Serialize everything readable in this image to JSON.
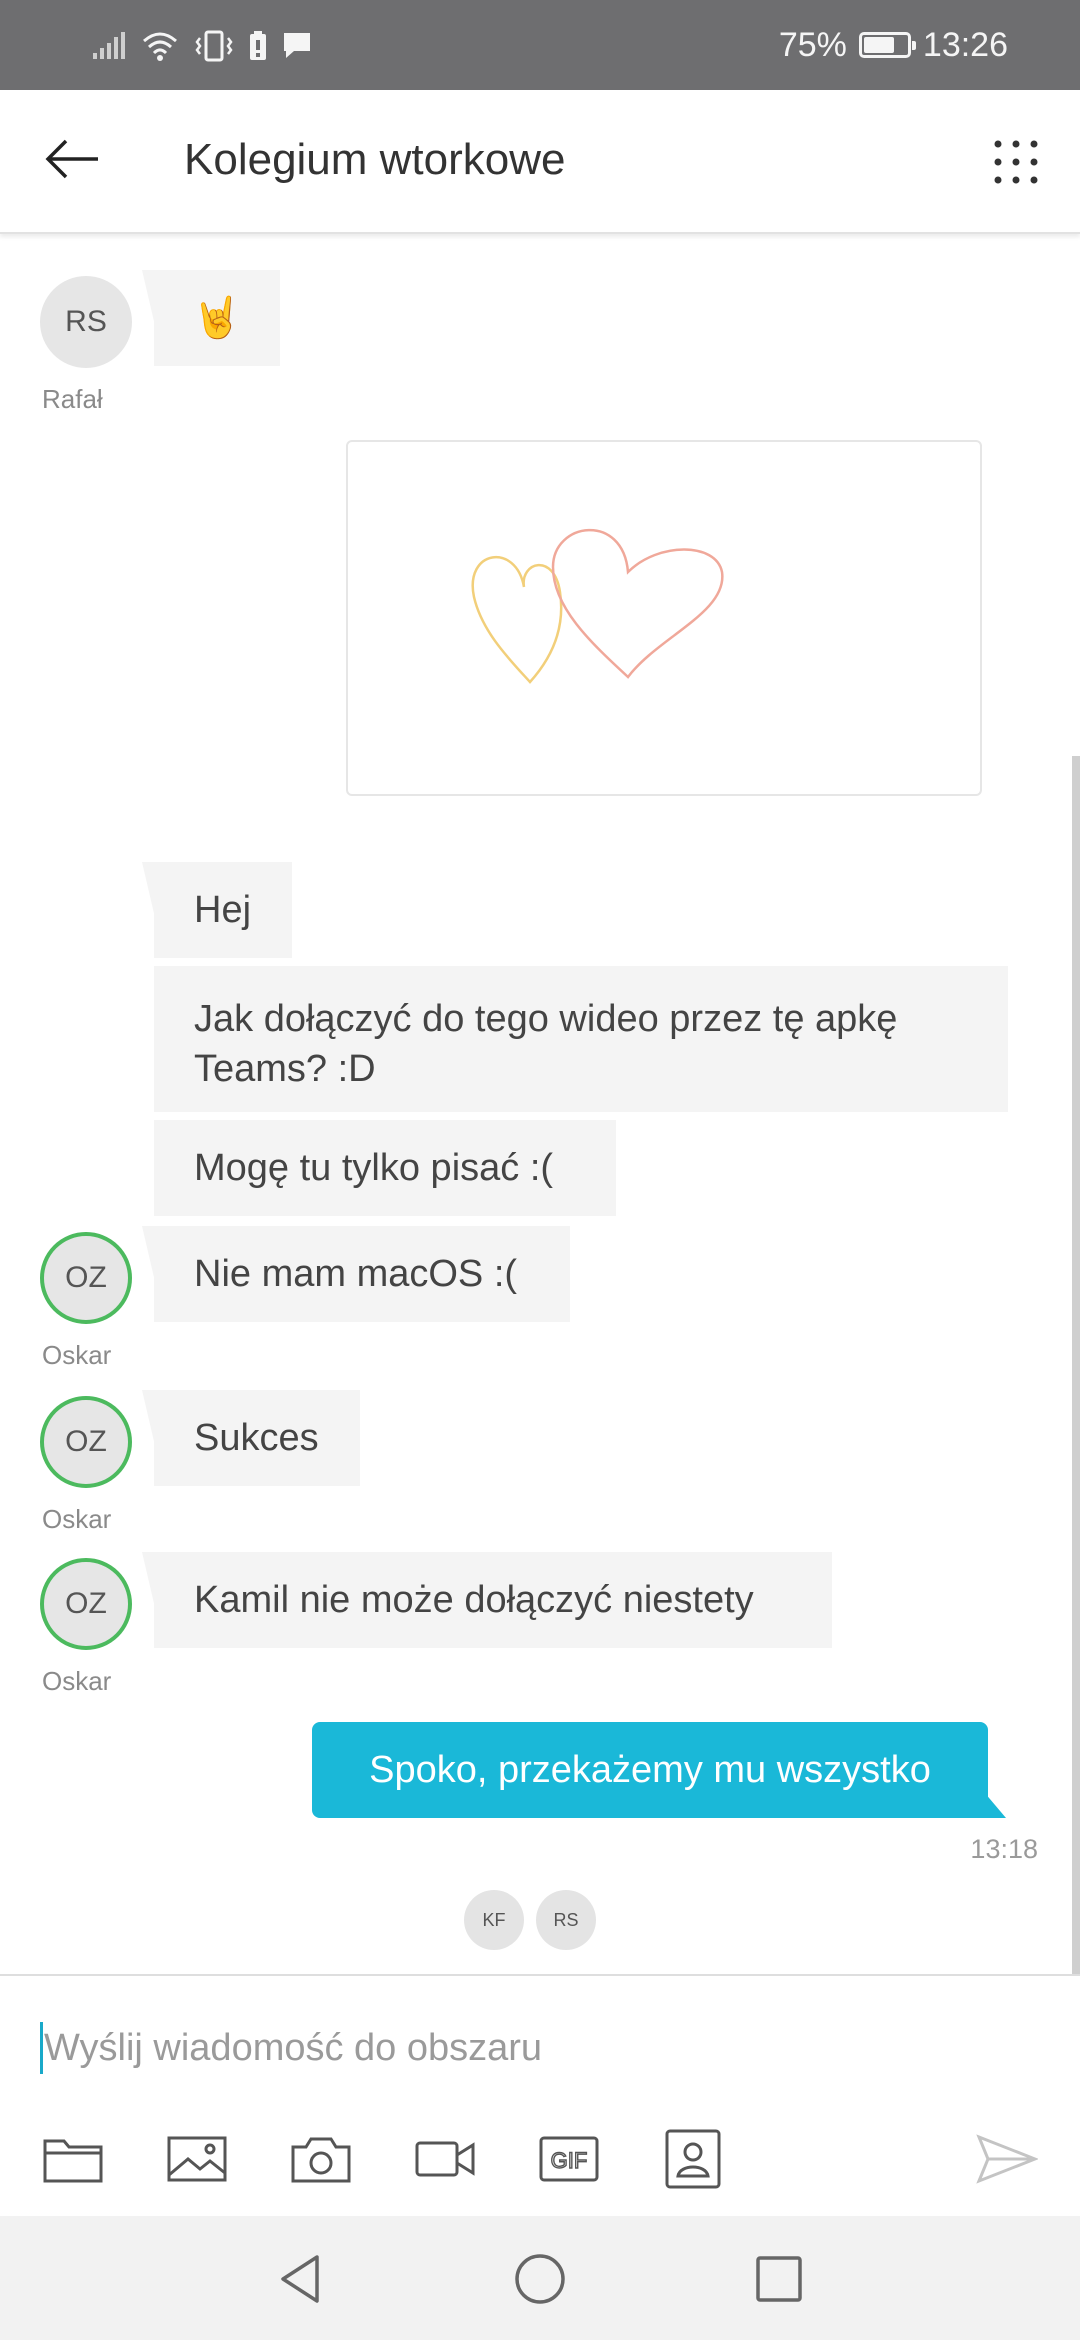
{
  "status_bar": {
    "battery_percent": "75%",
    "battery_level": 0.75,
    "time": "13:26",
    "icons": [
      "signal-icon",
      "wifi-icon",
      "vibrate-icon",
      "battery-saver-icon",
      "message-notification-icon"
    ]
  },
  "header": {
    "title": "Kolegium wtorkowe",
    "back_icon": "arrow-left-icon",
    "more_icon": "dots-grid-icon"
  },
  "messages": [
    {
      "avatar": "RS",
      "sender": "Rafał",
      "text": "🤘"
    },
    {
      "text": "Hej"
    },
    {
      "text": "Jak dołączyć do tego wideo przez tę apkę Teams? :D"
    },
    {
      "text": "Mogę tu tylko pisać :("
    },
    {
      "avatar": "OZ",
      "sender": "Oskar",
      "text": "Nie mam macOS :("
    },
    {
      "avatar": "OZ",
      "sender": "Oskar",
      "text": "Sukces"
    },
    {
      "avatar": "OZ",
      "sender": "Oskar",
      "text": "Kamil nie może dołączyć niestety"
    }
  ],
  "my_message": {
    "text": "Spoko, przekażemy mu wszystko",
    "time": "13:18"
  },
  "read_receipts": [
    "KF",
    "RS"
  ],
  "compose": {
    "placeholder": "Wyślij wiadomość do obszaru",
    "tools": [
      "folder-icon",
      "image-icon",
      "camera-icon",
      "video-icon",
      "gif-icon",
      "contact-icon",
      "send-icon"
    ]
  },
  "colors": {
    "status_bar": "#6e6e70",
    "accent": "#1ab8d8",
    "online": "#4cba5e",
    "bubble": "#f4f4f4"
  }
}
